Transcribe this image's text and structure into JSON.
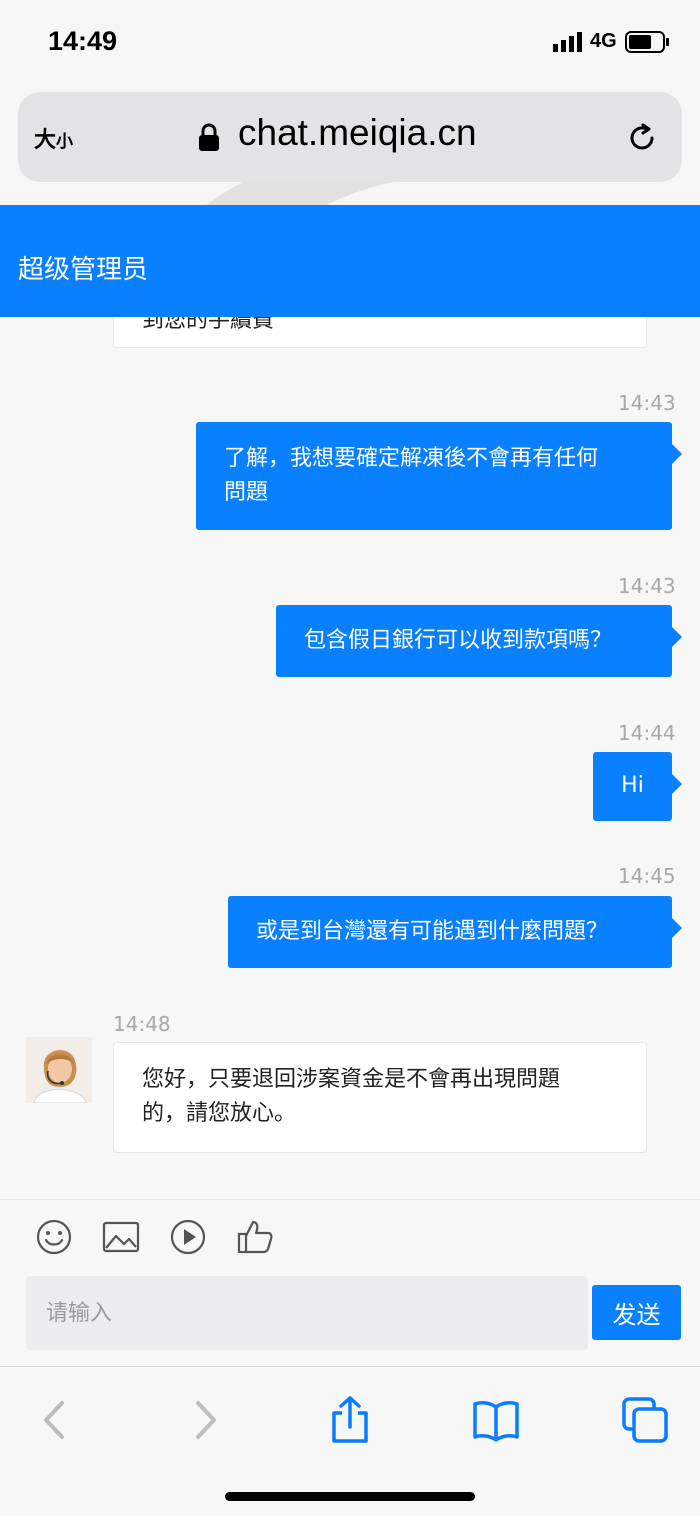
{
  "status_bar": {
    "time": "14:49",
    "network": "4G"
  },
  "address_bar": {
    "text_size_label": "大",
    "text_size_small": "小",
    "url": "chat.meiqia.cn"
  },
  "header": {
    "title": "超级管理员"
  },
  "messages": [
    {
      "direction": "in",
      "text": "到您的手續費",
      "partial": true
    },
    {
      "direction": "out",
      "time": "14:43",
      "lines": [
        "了解，我想要確定解凍後不會再有任何",
        "問題"
      ]
    },
    {
      "direction": "out",
      "time": "14:43",
      "lines": [
        "包含假日銀行可以收到款項嗎？"
      ]
    },
    {
      "direction": "out",
      "time": "14:44",
      "lines": [
        "Hi"
      ]
    },
    {
      "direction": "out",
      "time": "14:45",
      "lines": [
        "或是到台灣還有可能遇到什麼問題？"
      ]
    },
    {
      "direction": "in",
      "time": "14:48",
      "lines": [
        "您好，只要退回涉案資金是不會再出現問題",
        "的，請您放心。"
      ]
    }
  ],
  "composer": {
    "placeholder": "请输入",
    "send_label": "发送",
    "tools": [
      "emoji-icon",
      "image-icon",
      "video-icon",
      "thumbs-up-icon"
    ]
  },
  "colors": {
    "accent": "#0880ff",
    "timestamp": "#a8a8a8"
  }
}
